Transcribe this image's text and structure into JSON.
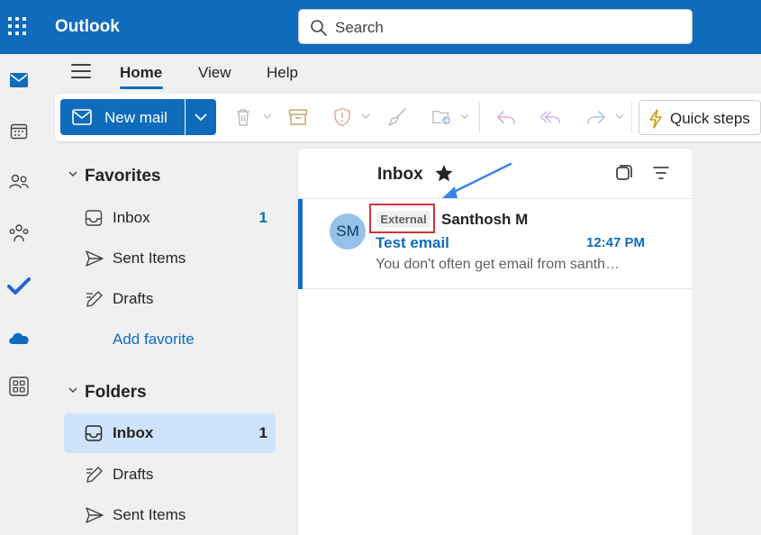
{
  "app": {
    "title": "Outlook"
  },
  "search": {
    "placeholder": "Search"
  },
  "rail": {
    "items": [
      {
        "icon": "mail-icon",
        "active": true
      },
      {
        "icon": "calendar-icon"
      },
      {
        "icon": "people-icon"
      },
      {
        "icon": "groups-icon"
      },
      {
        "icon": "todo-icon"
      },
      {
        "icon": "onedrive-icon"
      },
      {
        "icon": "apps-icon"
      }
    ]
  },
  "ribbon": {
    "tabs": [
      {
        "label": "Home",
        "selected": true
      },
      {
        "label": "View"
      },
      {
        "label": "Help"
      }
    ],
    "new_mail_label": "New mail",
    "quick_steps_label": "Quick steps",
    "icons": [
      "delete-icon",
      "archive-icon",
      "report-icon",
      "sweep-icon",
      "move-icon",
      "reply-icon",
      "reply-all-icon",
      "forward-icon"
    ]
  },
  "folder_pane": {
    "favorites": {
      "label": "Favorites",
      "items": [
        {
          "label": "Inbox",
          "count": "1"
        },
        {
          "label": "Sent Items"
        },
        {
          "label": "Drafts"
        }
      ],
      "add_favorite_label": "Add favorite"
    },
    "folders": {
      "label": "Folders",
      "items": [
        {
          "label": "Inbox",
          "count": "1",
          "selected": true
        },
        {
          "label": "Drafts"
        },
        {
          "label": "Sent Items"
        }
      ]
    }
  },
  "message_list": {
    "title": "Inbox",
    "messages": [
      {
        "initials": "SM",
        "tag": "External",
        "sender": "Santhosh M",
        "subject": "Test email",
        "time": "12:47 PM",
        "preview": "You don't often get email from santh…"
      }
    ]
  },
  "colors": {
    "brand": "#0f6cbd",
    "selected_folder": "#cfe4fa",
    "highlight_box": "#d13438",
    "annotation_arrow": "#3a86e8"
  }
}
